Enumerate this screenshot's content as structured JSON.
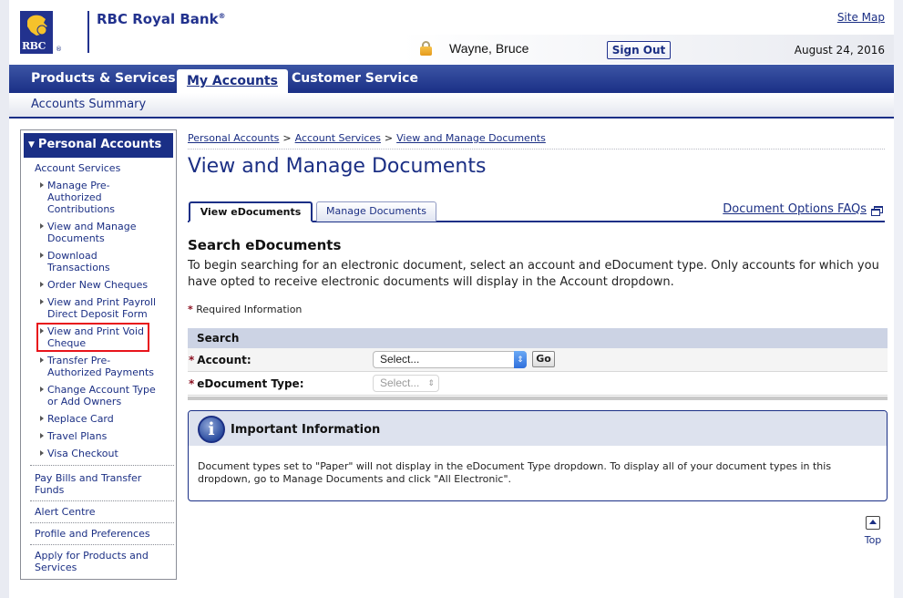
{
  "header": {
    "logo_text": "RBC",
    "brand_name": "RBC Royal Bank",
    "brand_mark": "®",
    "site_map": "Site Map",
    "user_name": "Wayne, Bruce",
    "sign_out": "Sign Out",
    "date": "August 24, 2016"
  },
  "main_nav": {
    "items": [
      {
        "label": "Products & Services",
        "active": false
      },
      {
        "label": "My Accounts",
        "active": true
      },
      {
        "label": "Customer Service",
        "active": false
      }
    ]
  },
  "sub_nav": {
    "accounts_summary": "Accounts Summary"
  },
  "sidebar": {
    "heading": "Personal Accounts",
    "subheading": "Account Services",
    "items": [
      {
        "label": "Manage Pre-Authorized Contributions"
      },
      {
        "label": "View and Manage Documents"
      },
      {
        "label": "Download Transactions"
      },
      {
        "label": "Order New Cheques"
      },
      {
        "label": "View and Print Payroll Direct Deposit Form"
      },
      {
        "label": "View and Print Void Cheque",
        "highlighted": true
      },
      {
        "label": "Transfer Pre-Authorized Payments"
      },
      {
        "label": "Change Account Type or Add Owners"
      },
      {
        "label": "Replace Card"
      },
      {
        "label": "Travel Plans"
      },
      {
        "label": "Visa Checkout"
      }
    ],
    "links": [
      "Pay Bills and Transfer Funds",
      "Alert Centre",
      "Profile and Preferences",
      "Apply for Products and Services"
    ]
  },
  "breadcrumb": [
    "Personal Accounts",
    "Account Services",
    "View and Manage Documents"
  ],
  "breadcrumb_separator": ">",
  "page_title": "View and Manage Documents",
  "tabs": [
    {
      "label": "View eDocuments",
      "active": true
    },
    {
      "label": "Manage Documents",
      "active": false
    }
  ],
  "faq_link": "Document Options FAQs",
  "search": {
    "title": "Search eDocuments",
    "intro": "To begin searching for an electronic document, select an account and eDocument type. Only accounts for which you have opted to receive electronic documents will display in the Account dropdown.",
    "required_marker": "*",
    "required_label": "Required Information",
    "table_heading": "Search",
    "account_label": "Account:",
    "account_value": "Select...",
    "go_button": "Go",
    "doctype_label": "eDocument Type:",
    "doctype_value": "Select..."
  },
  "info": {
    "title": "Important Information",
    "text": "Document types set to \"Paper\" will not display in the eDocument Type dropdown. To display all of your document types in this dropdown, go to Manage Documents and click \"All Electronic\"."
  },
  "top_link": "Top",
  "colors": {
    "brand_blue": "#1a2f86",
    "link_blue": "#1b2f84",
    "highlight_red": "#e8141b",
    "required_red": "#8b1020"
  }
}
